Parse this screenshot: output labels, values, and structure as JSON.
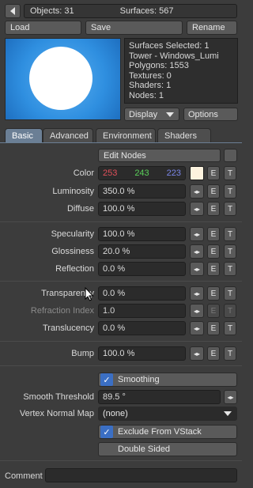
{
  "header": {
    "objects": "Objects: 31",
    "surfaces": "Surfaces: 567"
  },
  "toolbar": {
    "load": "Load",
    "save": "Save",
    "rename": "Rename"
  },
  "info": {
    "lines": [
      "Surfaces Selected: 1",
      "Tower - Windows_Lumi",
      "Polygons: 1553",
      "Textures: 0",
      "Shaders: 1",
      "Nodes: 1"
    ]
  },
  "display": {
    "label": "Display",
    "options": "Options"
  },
  "tabs": [
    "Basic",
    "Advanced",
    "Environment",
    "Shaders"
  ],
  "edit_nodes": "Edit Nodes",
  "color": {
    "label": "Color",
    "r": "253",
    "g": "243",
    "b": "223",
    "swatch": "#fdf3df"
  },
  "props": {
    "luminosity": {
      "label": "Luminosity",
      "value": "350.0 %"
    },
    "diffuse": {
      "label": "Diffuse",
      "value": "100.0 %"
    },
    "specularity": {
      "label": "Specularity",
      "value": "100.0 %"
    },
    "glossiness": {
      "label": "Glossiness",
      "value": "20.0 %"
    },
    "reflection": {
      "label": "Reflection",
      "value": "0.0 %"
    },
    "transparency": {
      "label": "Transparency",
      "value": "0.0 %"
    },
    "refraction": {
      "label": "Refraction Index",
      "value": "1.0"
    },
    "translucency": {
      "label": "Translucency",
      "value": "0.0 %"
    },
    "bump": {
      "label": "Bump",
      "value": "100.0 %"
    }
  },
  "et": {
    "e": "E",
    "t": "T"
  },
  "smoothing": "Smoothing",
  "smooth_threshold": {
    "label": "Smooth Threshold",
    "value": "89.5 °"
  },
  "vertex_normal_map": {
    "label": "Vertex Normal Map",
    "value": "(none)"
  },
  "exclude_vstack": "Exclude From VStack",
  "double_sided": "Double Sided",
  "comment": {
    "label": "Comment",
    "value": ""
  },
  "colors": {
    "r": "#e0505a",
    "g": "#5ad05a",
    "b": "#7a86e8",
    "accent": "#3b6fc4"
  }
}
